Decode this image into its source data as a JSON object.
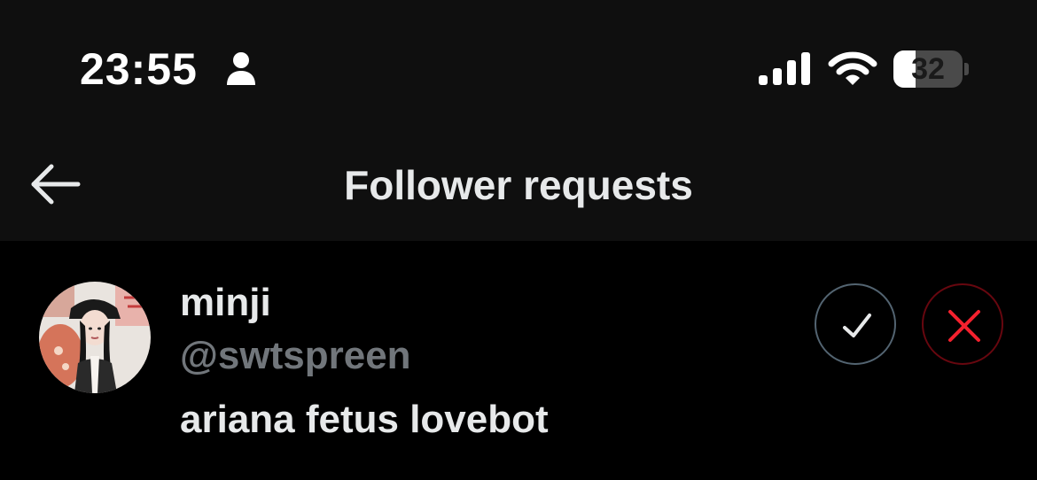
{
  "status_bar": {
    "time": "23:55",
    "battery_level": 32,
    "battery_text": "32",
    "icons": [
      "person-icon",
      "signal-icon",
      "wifi-icon",
      "battery-icon"
    ]
  },
  "header": {
    "title": "Follower requests",
    "back_icon": "arrow-left-icon"
  },
  "requests": [
    {
      "display_name": "minji",
      "handle": "@swtspreen",
      "bio": "ariana fetus lovebot",
      "accept_icon": "checkmark-icon",
      "decline_icon": "close-icon"
    }
  ],
  "colors": {
    "background": "#000000",
    "header_background": "#0f0f0f",
    "text_primary": "#e7e9ea",
    "text_secondary": "#71767b",
    "accept_border": "#536471",
    "decline_border": "#67070f",
    "decline_icon": "#f4212e"
  }
}
